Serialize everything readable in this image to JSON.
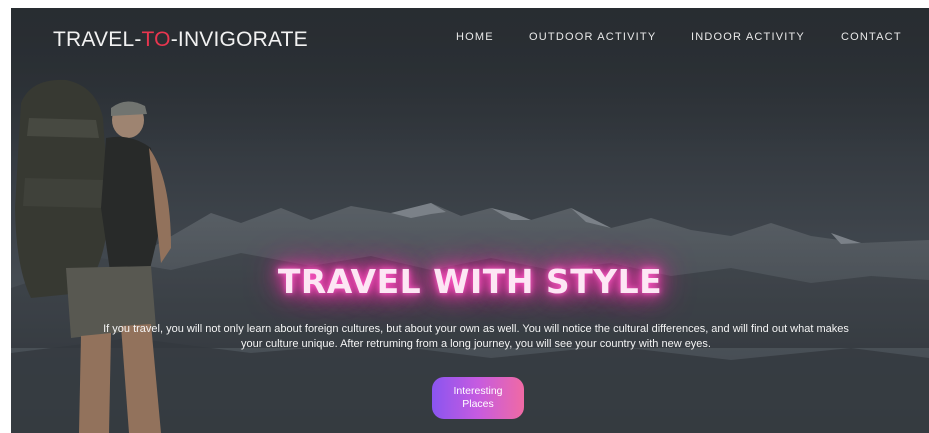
{
  "header": {
    "logo": {
      "part1": "TRAVEL-",
      "part2": "TO",
      "part3": "-INVIGORATE"
    },
    "nav": [
      {
        "label": "HOME"
      },
      {
        "label": "OUTDOOR ACTIVITY"
      },
      {
        "label": "INDOOR ACTIVITY"
      },
      {
        "label": "CONTACT"
      }
    ]
  },
  "hero": {
    "headline": "TRAVEL WITH STYLE",
    "paragraph": "If you travel, you will not only learn about foreign cultures, but about your own as well. You will notice the cultural differences, and will find out what makes your culture unique. After retruming from a long journey, you will see your country with new eyes.",
    "button_label": "Interesting Places",
    "background_image": "hiker-with-backpack-overlooking-mountains"
  },
  "colors": {
    "logo_text": "#f2f2f2",
    "logo_accent": "#e8364f",
    "headline_glow": "#ff2aa8",
    "button_gradient_start": "#8a55f0",
    "button_gradient_end": "#f06aa4"
  }
}
